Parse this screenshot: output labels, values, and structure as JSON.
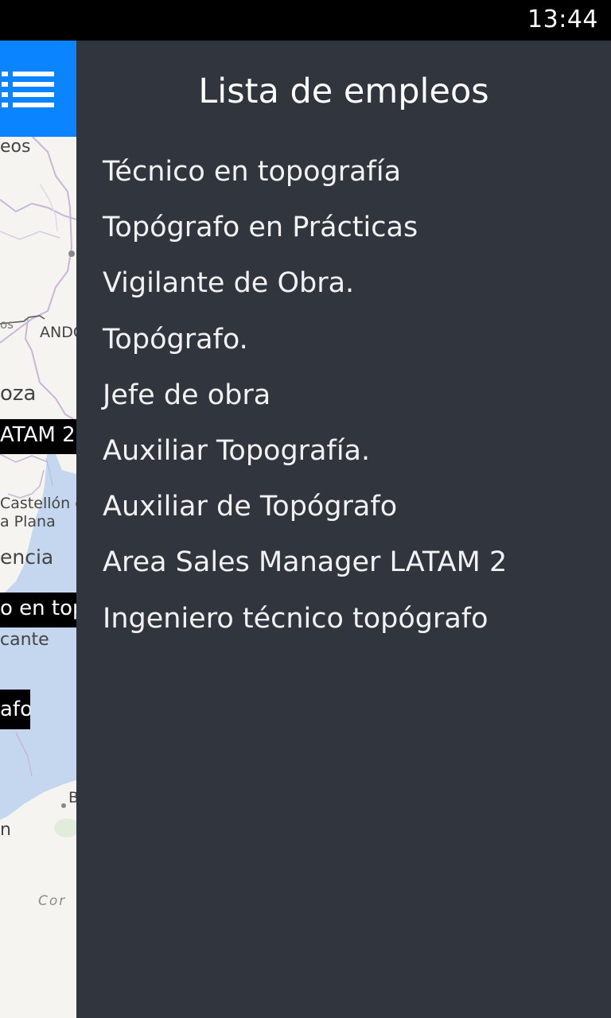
{
  "status_bar": {
    "time": "13:44"
  },
  "menu_button": {
    "icon": "list-icon"
  },
  "map": {
    "labels": {
      "leos": "eos",
      "ando": "ANDO",
      "os": "os",
      "oza": "oza",
      "castellon_1": "Castellón c",
      "castellon_2": "a Plana",
      "valencia": "encia",
      "alicante": "cante",
      "b": "B",
      "n": "n",
      "cor": "Cor"
    },
    "pins": {
      "latam": "ATAM 2",
      "tecnico": "o en top",
      "topografo": "afo"
    }
  },
  "drawer": {
    "title": "Lista de empleos",
    "jobs": [
      "Técnico en topografía",
      "Topógrafo en Prácticas",
      "Vigilante de Obra.",
      "Topógrafo.",
      "Jefe de obra",
      "Auxiliar Topografía.",
      "Auxiliar de Topógrafo",
      "Area Sales Manager LATAM 2",
      "Ingeniero técnico topógrafo"
    ]
  },
  "colors": {
    "drawer_bg": "#31353e",
    "accent": "#0a84ff",
    "map_bg": "#f6f4f0",
    "sea": "#c4d7ef"
  }
}
